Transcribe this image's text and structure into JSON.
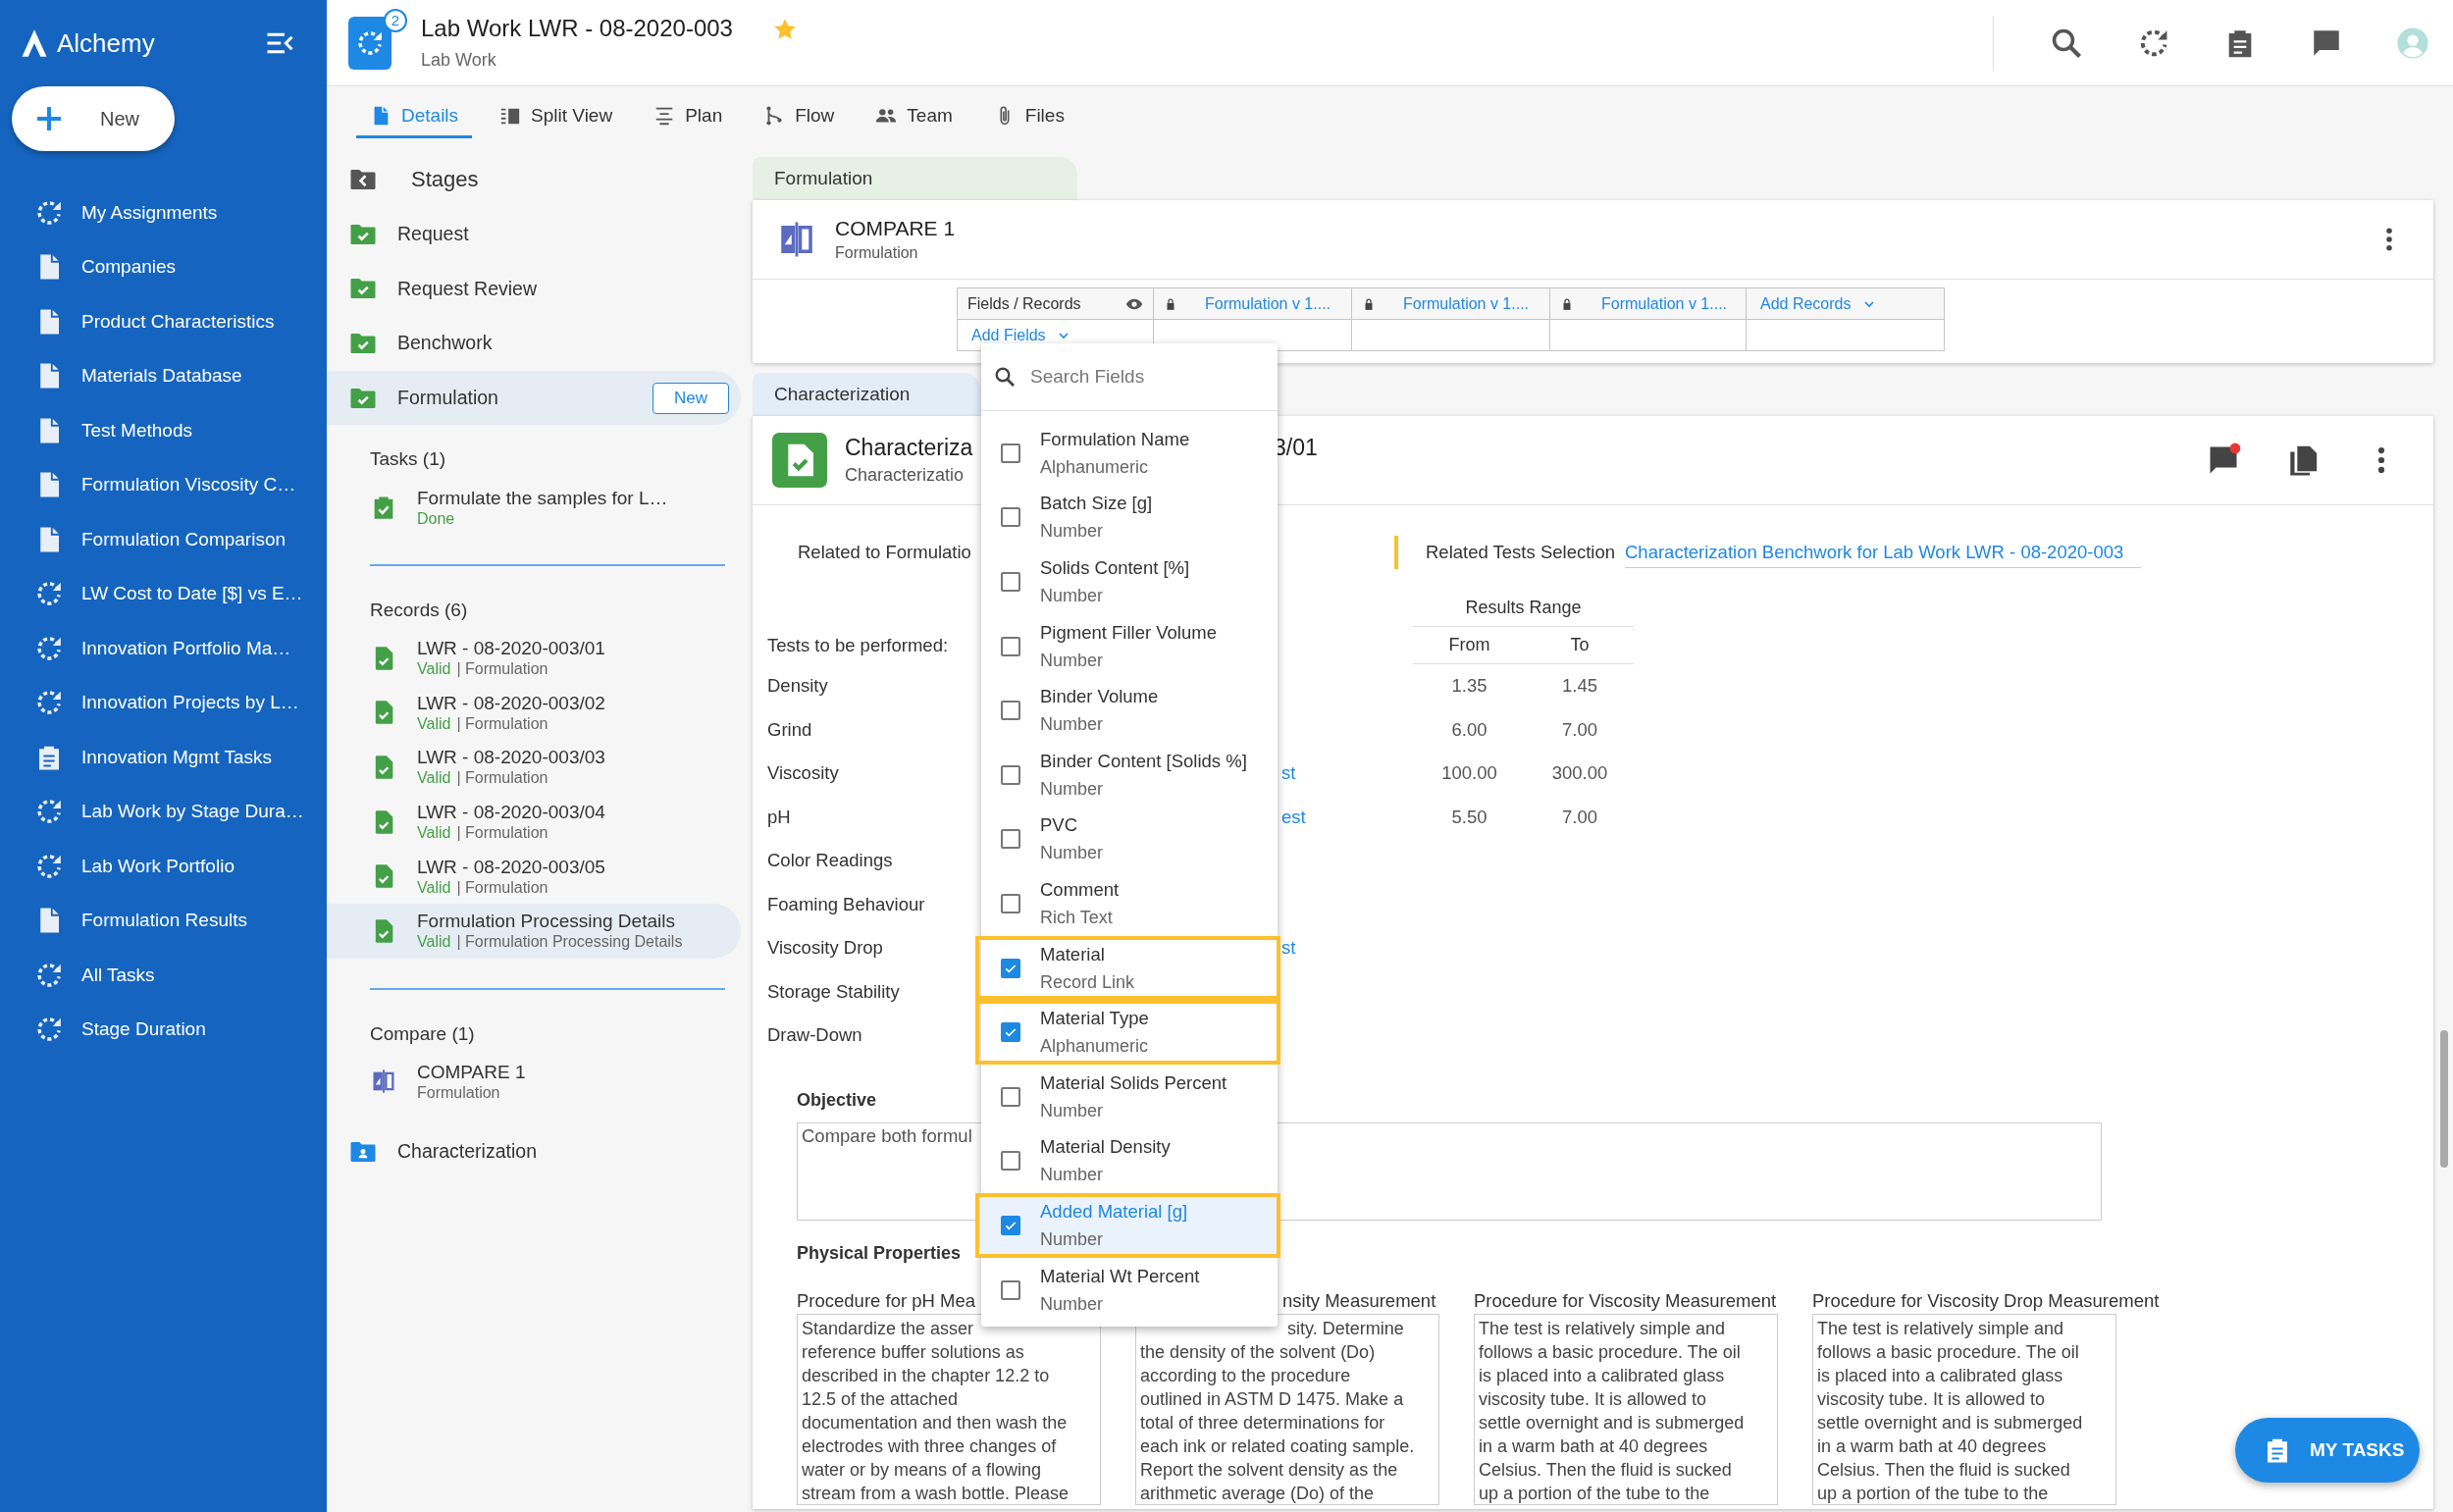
{
  "sidebar": {
    "logo": "Alchemy",
    "new_button": "New",
    "items": [
      {
        "label": "My Assignments",
        "kind": "dashboard"
      },
      {
        "label": "Companies",
        "kind": "page"
      },
      {
        "label": "Product Characteristics",
        "kind": "page"
      },
      {
        "label": "Materials Database",
        "kind": "page"
      },
      {
        "label": "Test Methods",
        "kind": "page"
      },
      {
        "label": "Formulation Viscosity C…",
        "kind": "page"
      },
      {
        "label": "Formulation Comparison",
        "kind": "page"
      },
      {
        "label": "LW Cost to Date [$] vs E…",
        "kind": "dashboard"
      },
      {
        "label": "Innovation Portfolio Ma…",
        "kind": "dashboard"
      },
      {
        "label": "Innovation Projects by L…",
        "kind": "dashboard"
      },
      {
        "label": "Innovation Mgmt Tasks",
        "kind": "tasks"
      },
      {
        "label": "Lab Work by Stage Dura…",
        "kind": "dashboard"
      },
      {
        "label": "Lab Work Portfolio",
        "kind": "dashboard"
      },
      {
        "label": "Formulation Results",
        "kind": "page"
      },
      {
        "label": "All Tasks",
        "kind": "dashboard"
      },
      {
        "label": "Stage Duration",
        "kind": "dashboard"
      }
    ]
  },
  "header": {
    "app_badge": "2",
    "title": "Lab Work LWR - 08-2020-003",
    "subtitle": "Lab Work",
    "starred": true
  },
  "tabs": [
    {
      "label": "Details",
      "selected": true
    },
    {
      "label": "Split View",
      "selected": false
    },
    {
      "label": "Plan",
      "selected": false
    },
    {
      "label": "Flow",
      "selected": false
    },
    {
      "label": "Team",
      "selected": false
    },
    {
      "label": "Files",
      "selected": false
    }
  ],
  "stages": {
    "title": "Stages",
    "items": [
      {
        "label": "Request",
        "kind": "done",
        "selected": false
      },
      {
        "label": "Request Review",
        "kind": "done",
        "selected": false
      },
      {
        "label": "Benchwork",
        "kind": "done",
        "selected": false
      },
      {
        "label": "Formulation",
        "kind": "done",
        "selected": true,
        "action": "New"
      }
    ],
    "tasks": {
      "title": "Tasks (1)",
      "items": [
        {
          "name": "Formulate the samples for L…",
          "status": "Done"
        }
      ]
    },
    "records": {
      "title": "Records (6)",
      "items": [
        {
          "name": "LWR - 08-2020-003/01",
          "status": "Valid",
          "type": "| Formulation",
          "selected": false
        },
        {
          "name": "LWR - 08-2020-003/02",
          "status": "Valid",
          "type": "| Formulation",
          "selected": false
        },
        {
          "name": "LWR - 08-2020-003/03",
          "status": "Valid",
          "type": "| Formulation",
          "selected": false
        },
        {
          "name": "LWR - 08-2020-003/04",
          "status": "Valid",
          "type": "| Formulation",
          "selected": false
        },
        {
          "name": "LWR - 08-2020-003/05",
          "status": "Valid",
          "type": "| Formulation",
          "selected": false
        },
        {
          "name": "Formulation Processing Details",
          "status": "Valid",
          "type": "| Formulation Processing Details",
          "selected": true
        }
      ]
    },
    "compare": {
      "title": "Compare (1)",
      "items": [
        {
          "name": "COMPARE 1",
          "type": "Formulation"
        }
      ]
    },
    "next_stages": [
      {
        "label": "Characterization",
        "kind": "current",
        "selected": false
      }
    ]
  },
  "formulation_section": {
    "label": "Formulation",
    "card": {
      "title": "COMPARE 1",
      "subtitle": "Formulation",
      "table": {
        "columns": [
          {
            "label": "Fields / Records",
            "kind": "fields"
          },
          {
            "label": "Formulation v 1....",
            "kind": "record"
          },
          {
            "label": "Formulation v 1....",
            "kind": "record"
          },
          {
            "label": "Formulation v 1....",
            "kind": "record"
          },
          {
            "label": "Add Records",
            "kind": "add"
          }
        ],
        "add_fields": "Add Fields"
      }
    }
  },
  "characterization_section": {
    "label": "Characterization",
    "card": {
      "title_start": "Characteriza",
      "title_end": "3/01",
      "subtitle": "Characterizatio",
      "unread_comments": true,
      "related_formulation_label": "Related to Formulatio",
      "related_tests_label": "Related Tests Selection",
      "related_tests_link": "Characterization Benchwork for Lab Work LWR - 08-2020-003",
      "results_range": "Results Range",
      "from_label": "From",
      "to_label": "To",
      "tests_label": "Tests to be performed:",
      "tests": [
        {
          "name": "Density",
          "from": "1.35",
          "to": "1.45"
        },
        {
          "name": "Grind",
          "from": "6.00",
          "to": "7.00"
        },
        {
          "name": "Viscosity",
          "link": "st",
          "from": "100.00",
          "to": "300.00"
        },
        {
          "name": "pH",
          "link": "est",
          "from": "5.50",
          "to": "7.00"
        },
        {
          "name": "Color Readings"
        },
        {
          "name": "Foaming Behaviour"
        },
        {
          "name": "Viscosity Drop",
          "link": "st"
        },
        {
          "name": "Storage Stability"
        },
        {
          "name": "Draw-Down"
        }
      ],
      "objective_label": "Objective",
      "objective_text": "Compare both formul",
      "physical_properties": "Physical Properties",
      "procedures": [
        {
          "title": "Procedure for pH Mea",
          "lines": [
            "Standardize the asser",
            "reference buffer solutions as",
            "described in the chapter 12.2 to",
            "12.5 of the attached",
            "documentation and then wash the",
            "electrodes with three changes of",
            "water or by means of a flowing",
            "stream from a wash bottle. Please"
          ]
        },
        {
          "title": "nsity Measurement",
          "lines": [
            "sity. Determine",
            "the density of the solvent (Do)",
            "according to the procedure",
            "outlined in ASTM D 1475. Make a",
            "total of three determinations for",
            "each ink or related coating sample.",
            "Report the solvent density as the",
            "arithmetic average (Do) of the"
          ]
        },
        {
          "title": "Procedure for Viscosity Measurement",
          "lines": [
            "The test is relatively simple and",
            "follows a basic procedure. The oil",
            "is placed into a calibrated glass",
            "viscosity tube. It is allowed to",
            "settle overnight and is submerged",
            "in a warm bath at 40 degrees",
            "Celsius. Then the fluid is sucked",
            "up a portion of the tube to the"
          ]
        },
        {
          "title": "Procedure for Viscosity Drop Measurement",
          "lines": [
            "The test is relatively simple and",
            "follows a basic procedure. The oil",
            "is placed into a calibrated glass",
            "viscosity tube. It is allowed to",
            "settle overnight and is submerged",
            "in a warm bath at 40 degrees",
            "Celsius. Then the fluid is sucked",
            "up a portion of the tube to the"
          ]
        }
      ]
    }
  },
  "fields_dropdown": {
    "placeholder": "Search Fields",
    "items": [
      {
        "name": "Formulation Name",
        "type": "Alphanumeric",
        "checked": false,
        "selected": false
      },
      {
        "name": "Batch Size [g]",
        "type": "Number",
        "checked": false,
        "selected": false
      },
      {
        "name": "Solids Content [%]",
        "type": "Number",
        "checked": false,
        "selected": false
      },
      {
        "name": "Pigment Filler Volume",
        "type": "Number",
        "checked": false,
        "selected": false
      },
      {
        "name": "Binder Volume",
        "type": "Number",
        "checked": false,
        "selected": false
      },
      {
        "name": "Binder Content [Solids %]",
        "type": "Number",
        "checked": false,
        "selected": false
      },
      {
        "name": "PVC",
        "type": "Number",
        "checked": false,
        "selected": false
      },
      {
        "name": "Comment",
        "type": "Rich Text",
        "checked": false,
        "selected": false
      },
      {
        "name": "Material",
        "type": "Record Link",
        "checked": true,
        "selected": false
      },
      {
        "name": "Material Type",
        "type": "Alphanumeric",
        "checked": true,
        "selected": false
      },
      {
        "name": "Material Solids Percent",
        "type": "Number",
        "checked": false,
        "selected": false
      },
      {
        "name": "Material Density",
        "type": "Number",
        "checked": false,
        "selected": false
      },
      {
        "name": "Added Material [g]",
        "type": "Number",
        "checked": true,
        "selected": true
      },
      {
        "name": "Material Wt Percent",
        "type": "Number",
        "checked": false,
        "selected": false
      }
    ]
  },
  "my_tasks_button": "MY TASKS"
}
